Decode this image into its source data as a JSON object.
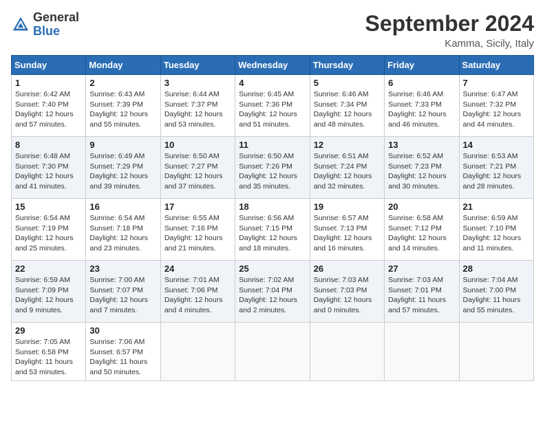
{
  "header": {
    "logo_general": "General",
    "logo_blue": "Blue",
    "month_title": "September 2024",
    "location": "Kamma, Sicily, Italy"
  },
  "days_of_week": [
    "Sunday",
    "Monday",
    "Tuesday",
    "Wednesday",
    "Thursday",
    "Friday",
    "Saturday"
  ],
  "weeks": [
    [
      {
        "day": "1",
        "sunrise": "6:42 AM",
        "sunset": "7:40 PM",
        "daylight": "12 hours and 57 minutes."
      },
      {
        "day": "2",
        "sunrise": "6:43 AM",
        "sunset": "7:39 PM",
        "daylight": "12 hours and 55 minutes."
      },
      {
        "day": "3",
        "sunrise": "6:44 AM",
        "sunset": "7:37 PM",
        "daylight": "12 hours and 53 minutes."
      },
      {
        "day": "4",
        "sunrise": "6:45 AM",
        "sunset": "7:36 PM",
        "daylight": "12 hours and 51 minutes."
      },
      {
        "day": "5",
        "sunrise": "6:46 AM",
        "sunset": "7:34 PM",
        "daylight": "12 hours and 48 minutes."
      },
      {
        "day": "6",
        "sunrise": "6:46 AM",
        "sunset": "7:33 PM",
        "daylight": "12 hours and 46 minutes."
      },
      {
        "day": "7",
        "sunrise": "6:47 AM",
        "sunset": "7:32 PM",
        "daylight": "12 hours and 44 minutes."
      }
    ],
    [
      {
        "day": "8",
        "sunrise": "6:48 AM",
        "sunset": "7:30 PM",
        "daylight": "12 hours and 41 minutes."
      },
      {
        "day": "9",
        "sunrise": "6:49 AM",
        "sunset": "7:29 PM",
        "daylight": "12 hours and 39 minutes."
      },
      {
        "day": "10",
        "sunrise": "6:50 AM",
        "sunset": "7:27 PM",
        "daylight": "12 hours and 37 minutes."
      },
      {
        "day": "11",
        "sunrise": "6:50 AM",
        "sunset": "7:26 PM",
        "daylight": "12 hours and 35 minutes."
      },
      {
        "day": "12",
        "sunrise": "6:51 AM",
        "sunset": "7:24 PM",
        "daylight": "12 hours and 32 minutes."
      },
      {
        "day": "13",
        "sunrise": "6:52 AM",
        "sunset": "7:23 PM",
        "daylight": "12 hours and 30 minutes."
      },
      {
        "day": "14",
        "sunrise": "6:53 AM",
        "sunset": "7:21 PM",
        "daylight": "12 hours and 28 minutes."
      }
    ],
    [
      {
        "day": "15",
        "sunrise": "6:54 AM",
        "sunset": "7:19 PM",
        "daylight": "12 hours and 25 minutes."
      },
      {
        "day": "16",
        "sunrise": "6:54 AM",
        "sunset": "7:18 PM",
        "daylight": "12 hours and 23 minutes."
      },
      {
        "day": "17",
        "sunrise": "6:55 AM",
        "sunset": "7:16 PM",
        "daylight": "12 hours and 21 minutes."
      },
      {
        "day": "18",
        "sunrise": "6:56 AM",
        "sunset": "7:15 PM",
        "daylight": "12 hours and 18 minutes."
      },
      {
        "day": "19",
        "sunrise": "6:57 AM",
        "sunset": "7:13 PM",
        "daylight": "12 hours and 16 minutes."
      },
      {
        "day": "20",
        "sunrise": "6:58 AM",
        "sunset": "7:12 PM",
        "daylight": "12 hours and 14 minutes."
      },
      {
        "day": "21",
        "sunrise": "6:59 AM",
        "sunset": "7:10 PM",
        "daylight": "12 hours and 11 minutes."
      }
    ],
    [
      {
        "day": "22",
        "sunrise": "6:59 AM",
        "sunset": "7:09 PM",
        "daylight": "12 hours and 9 minutes."
      },
      {
        "day": "23",
        "sunrise": "7:00 AM",
        "sunset": "7:07 PM",
        "daylight": "12 hours and 7 minutes."
      },
      {
        "day": "24",
        "sunrise": "7:01 AM",
        "sunset": "7:06 PM",
        "daylight": "12 hours and 4 minutes."
      },
      {
        "day": "25",
        "sunrise": "7:02 AM",
        "sunset": "7:04 PM",
        "daylight": "12 hours and 2 minutes."
      },
      {
        "day": "26",
        "sunrise": "7:03 AM",
        "sunset": "7:03 PM",
        "daylight": "12 hours and 0 minutes."
      },
      {
        "day": "27",
        "sunrise": "7:03 AM",
        "sunset": "7:01 PM",
        "daylight": "11 hours and 57 minutes."
      },
      {
        "day": "28",
        "sunrise": "7:04 AM",
        "sunset": "7:00 PM",
        "daylight": "11 hours and 55 minutes."
      }
    ],
    [
      {
        "day": "29",
        "sunrise": "7:05 AM",
        "sunset": "6:58 PM",
        "daylight": "11 hours and 53 minutes."
      },
      {
        "day": "30",
        "sunrise": "7:06 AM",
        "sunset": "6:57 PM",
        "daylight": "11 hours and 50 minutes."
      },
      null,
      null,
      null,
      null,
      null
    ]
  ]
}
